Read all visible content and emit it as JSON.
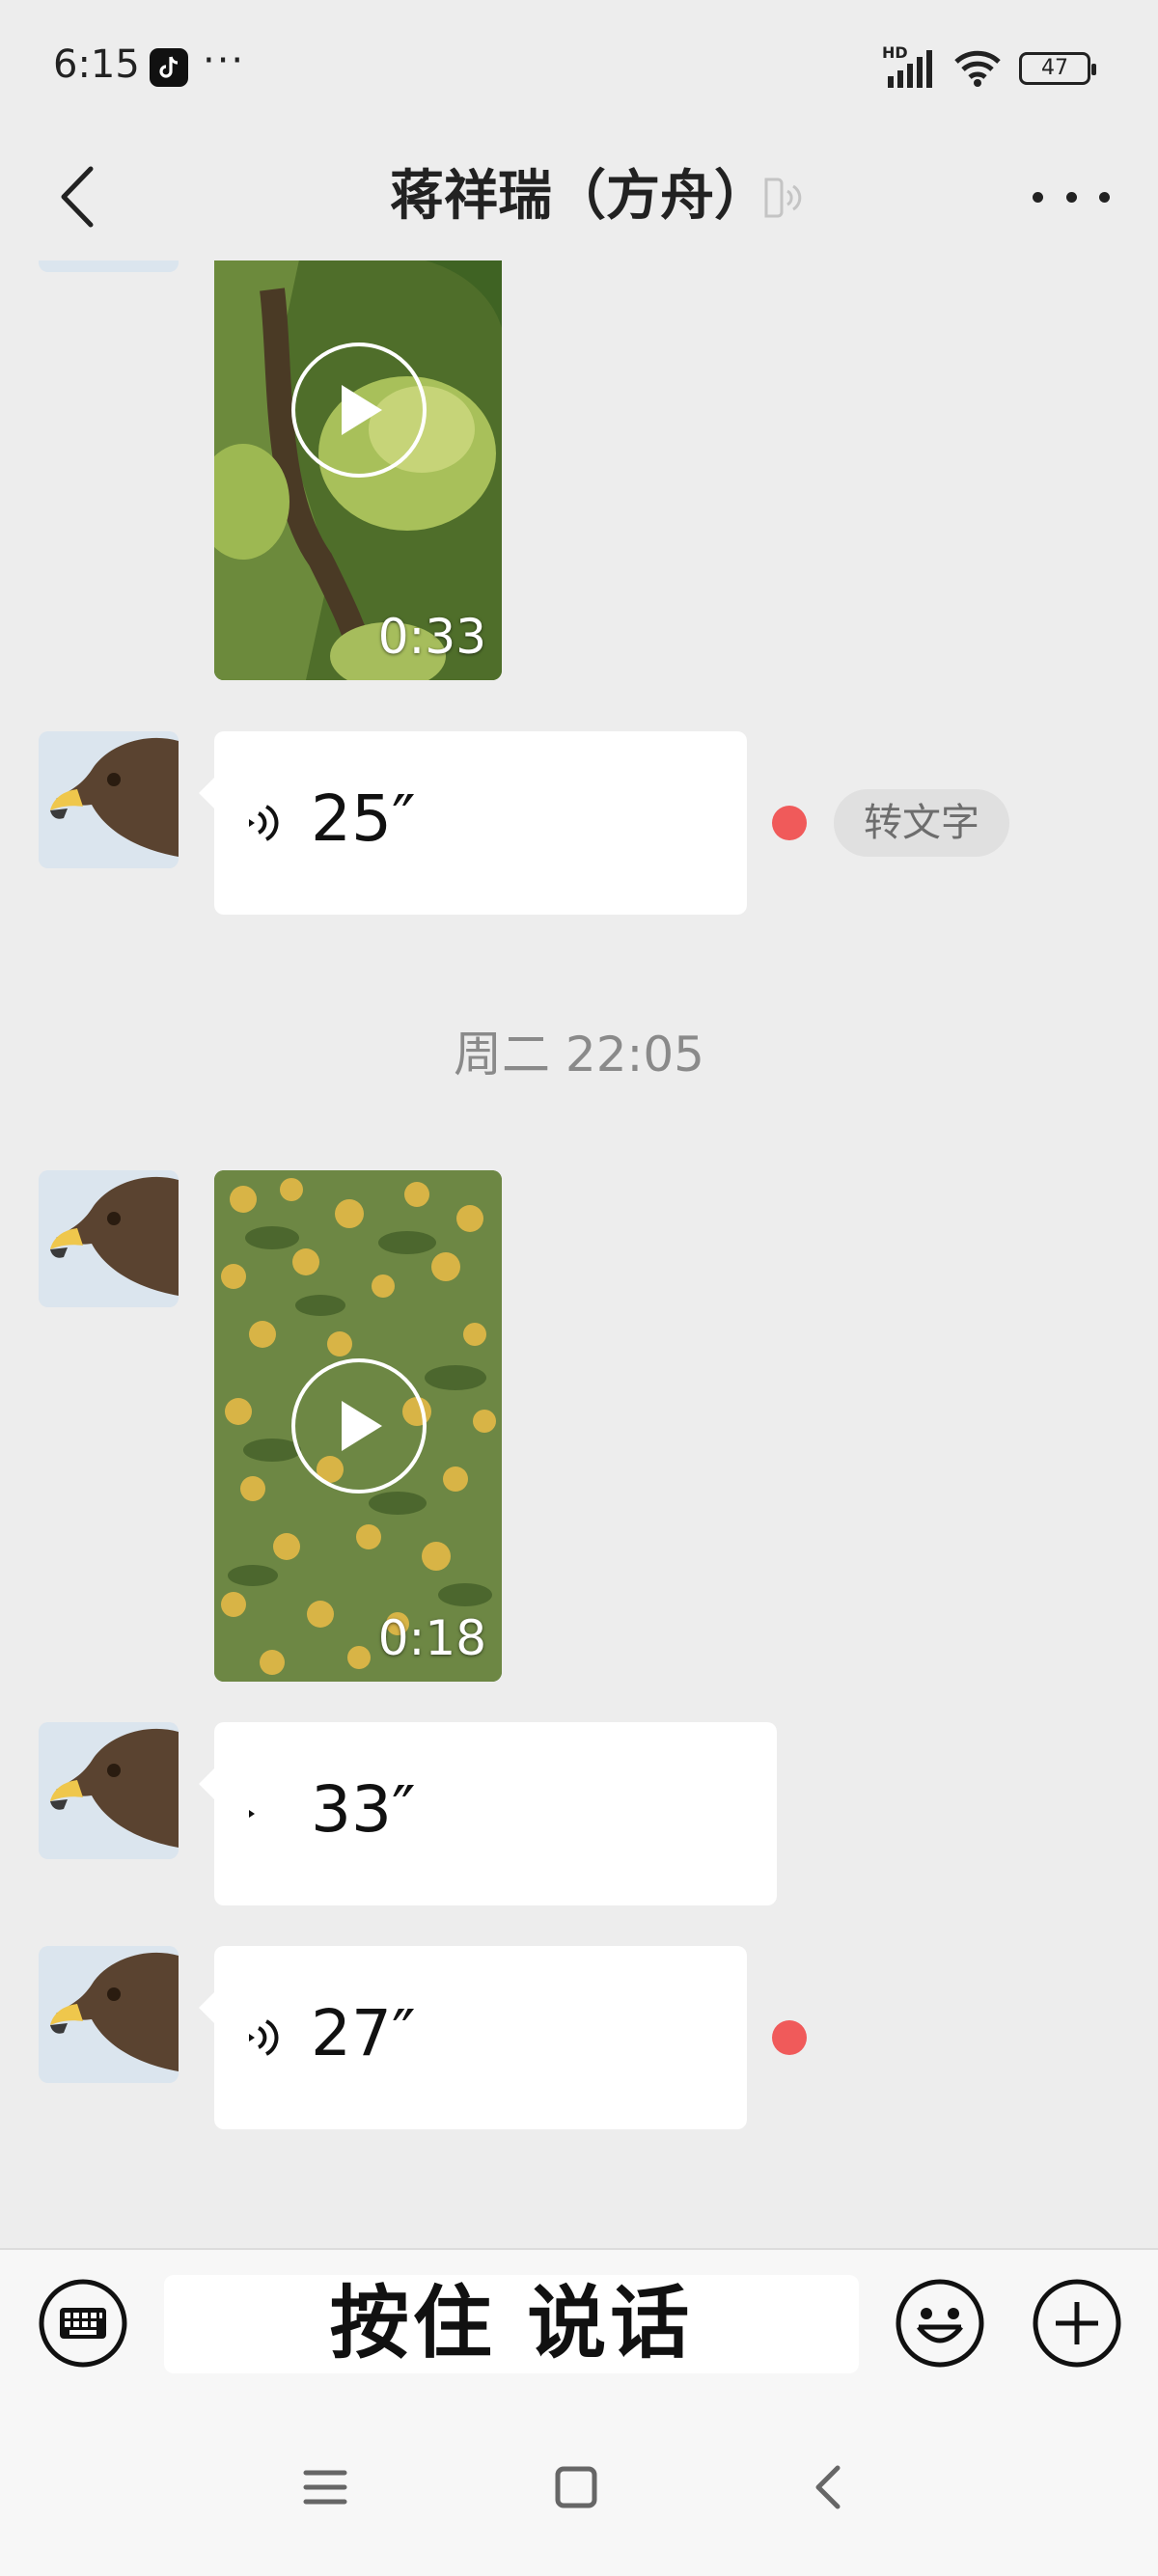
{
  "status_bar": {
    "time": "6:15",
    "more_dots": "···",
    "network_label": "HD",
    "battery": "47"
  },
  "header": {
    "title": "蒋祥瑞（方舟）"
  },
  "messages": {
    "video1": {
      "duration": "0:33"
    },
    "voice1": {
      "seconds": "25″",
      "to_text": "转文字"
    },
    "timestamp1": "周二 22:05",
    "video2": {
      "duration": "0:18"
    },
    "voice2": {
      "seconds": "33″"
    },
    "voice3": {
      "seconds": "27″"
    }
  },
  "input_bar": {
    "hold_to_talk": "按住 说话"
  },
  "colors": {
    "background": "#ededed",
    "bubble": "#ffffff",
    "unread_dot": "#f05a5a",
    "timestamp": "#8a8a8a"
  }
}
